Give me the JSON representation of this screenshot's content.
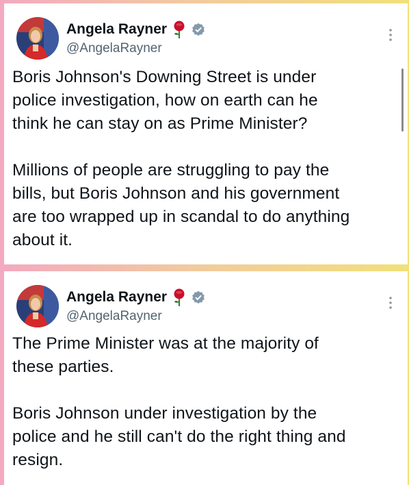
{
  "tweets": [
    {
      "author_name": "Angela Rayner",
      "handle": "@AngelaRayner",
      "rose_icon": "rose-emoji",
      "verified_icon": "verified-badge",
      "paragraphs": [
        [
          "Boris Johnson's Downing Street is under",
          "police investigation, how on earth can he",
          "think he can stay on as Prime Minister?"
        ],
        [
          "Millions of people are struggling to pay the",
          "bills, but Boris Johnson and his government",
          "are too wrapped up in scandal to do anything",
          "about it."
        ]
      ]
    },
    {
      "author_name": "Angela Rayner",
      "handle": "@AngelaRayner",
      "rose_icon": "rose-emoji",
      "verified_icon": "verified-badge",
      "paragraphs": [
        [
          "The Prime Minister was at the majority of",
          "these parties."
        ],
        [
          "Boris Johnson under investigation by the",
          "police and he still can't do the right thing and",
          "resign."
        ]
      ]
    }
  ],
  "colors": {
    "text": "#0f1419",
    "handle": "#536471",
    "verified": "#829aab",
    "rose": "#c8102e"
  }
}
